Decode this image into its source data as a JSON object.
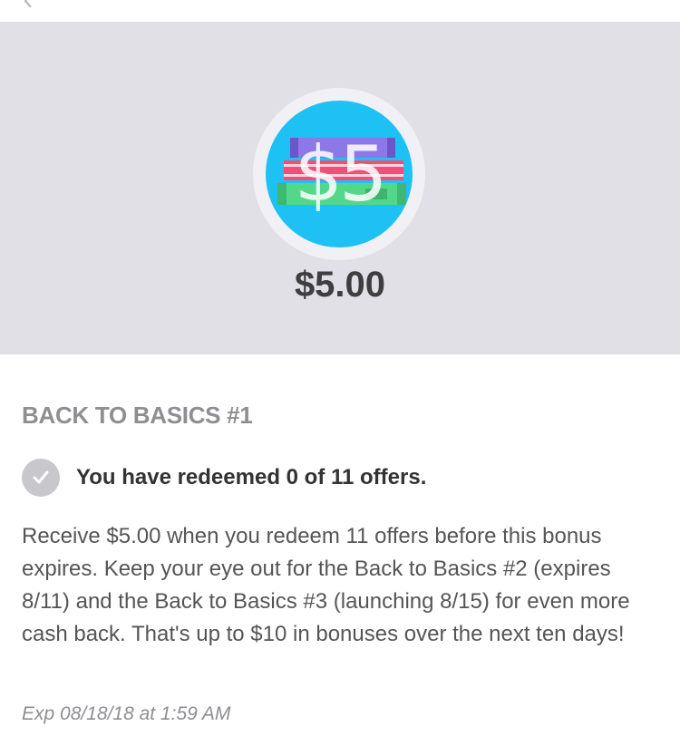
{
  "nav": {
    "back_icon": "chevron-left-icon"
  },
  "hero": {
    "badge_label": "$5",
    "badge_icon": "books-icon",
    "amount": "$5.00"
  },
  "offer": {
    "title": "BACK TO BASICS #1",
    "progress_icon": "check-icon",
    "progress_text": "You have redeemed 0 of 11 offers.",
    "description": "Receive $5.00 when you redeem 11 offers before this bonus expires. Keep your eye out for the Back to Basics #2 (expires 8/11) and the Back to Basics #3 (launching 8/15) for even more cash back. That's up to $10 in bonuses over the next ten days!",
    "expiry": "Exp 08/18/18 at 1:59 AM"
  },
  "colors": {
    "hero_background": "#e1e0e6",
    "badge_blue": "#1ec1f4",
    "check_gray": "#c7c7cc"
  }
}
